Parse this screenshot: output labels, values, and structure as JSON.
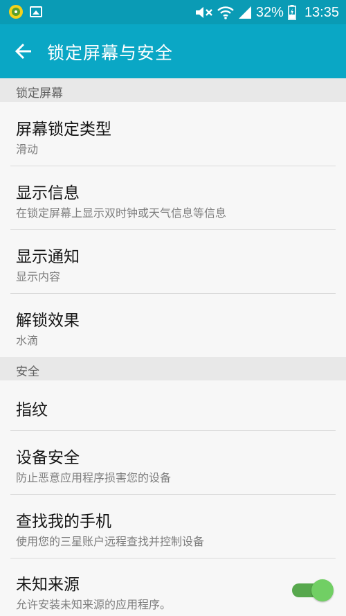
{
  "status_bar": {
    "battery": "32%",
    "time": "13:35",
    "icons": [
      "app-badge-icon",
      "gallery-icon",
      "mute-icon",
      "wifi-icon",
      "signal-icon",
      "battery-charging-icon"
    ]
  },
  "app_bar": {
    "title": "锁定屏幕与安全",
    "back_icon": "arrow-left-icon"
  },
  "sections": {
    "lock_screen": {
      "header": "锁定屏幕",
      "items": [
        {
          "title": "屏幕锁定类型",
          "subtitle": "滑动"
        },
        {
          "title": "显示信息",
          "subtitle": "在锁定屏幕上显示双时钟或天气信息等信息"
        },
        {
          "title": "显示通知",
          "subtitle": "显示内容"
        },
        {
          "title": "解锁效果",
          "subtitle": "水滴"
        }
      ]
    },
    "security": {
      "header": "安全",
      "items": [
        {
          "title": "指纹"
        },
        {
          "title": "设备安全",
          "subtitle": "防止恶意应用程序损害您的设备"
        },
        {
          "title": "查找我的手机",
          "subtitle": "使用您的三星账户远程查找并控制设备"
        },
        {
          "title": "未知来源",
          "subtitle": "允许安装未知来源的应用程序。",
          "toggle_on": true
        }
      ]
    }
  },
  "colors": {
    "status_bar": "#0a9bb5",
    "app_bar": "#0aa7c5",
    "toggle_on": "#71cf64"
  }
}
